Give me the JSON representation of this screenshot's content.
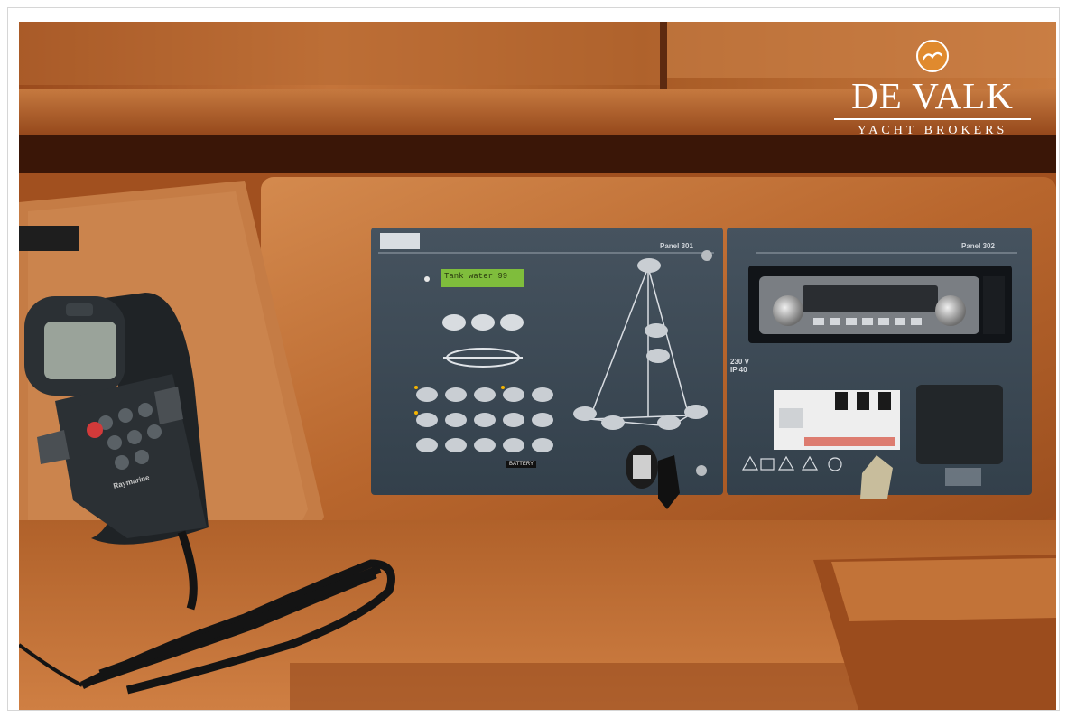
{
  "logo": {
    "name": "DE VALK",
    "tagline": "YACHT BROKERS",
    "icon": "seagull-icon"
  },
  "panel_left": {
    "label": "Panel 301",
    "lcd_text": "Tank water 99",
    "button_tag": "BATTERY"
  },
  "panel_right": {
    "label": "Panel 302",
    "voltage": "230 V",
    "rating": "IP 40"
  },
  "handset": {
    "brand": "Raymarine"
  },
  "colors": {
    "teak": "#b8642a",
    "panel": "#3d4a57",
    "logo_badge": "#e08a2e"
  }
}
